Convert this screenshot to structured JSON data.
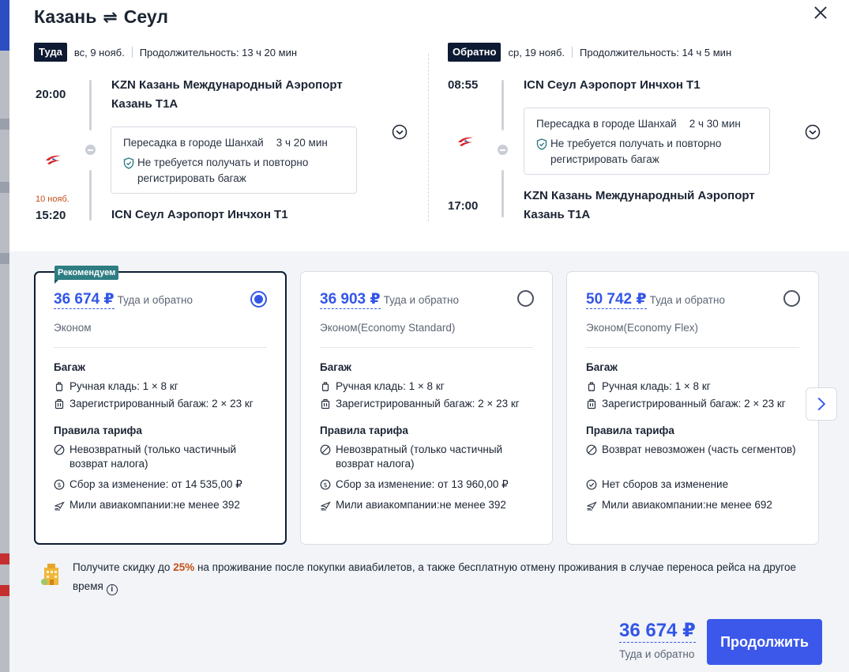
{
  "modal": {
    "origin": "Казань",
    "destination": "Сеул",
    "swap_icon": "⇌"
  },
  "outbound": {
    "tag": "Туда",
    "date": "вс, 9 нояб.",
    "duration": "Продолжительность: 13 ч 20 мин",
    "dep_time": "20:00",
    "dep_airport": "KZN Казань Международный Аэропорт Казань T1A",
    "arr_note": "10 нояб.",
    "arr_time": "15:20",
    "arr_airport": "ICN Сеул Аэропорт Инчхон T1",
    "transfer_city": "Пересадка в городе Шанхай",
    "transfer_time": "3 ч 20 мин",
    "transfer_note": "Не требуется получать и повторно регистрировать багаж"
  },
  "return": {
    "tag": "Обратно",
    "date": "ср, 19 нояб.",
    "duration": "Продолжительность: 14 ч 5 мин",
    "dep_time": "08:55",
    "dep_airport": "ICN Сеул Аэропорт Инчхон T1",
    "arr_time": "17:00",
    "arr_airport": "KZN Казань Международный Аэропорт Казань T1A",
    "transfer_city": "Пересадка в городе Шанхай",
    "transfer_time": "2 ч 30 мин",
    "transfer_note": "Не требуется получать и повторно регистрировать багаж"
  },
  "fares": [
    {
      "badge": "Рекомендуем",
      "price": "36 674 ₽",
      "price_sub": "Туда и обратно",
      "class": "Эконом",
      "selected": true,
      "baggage_title": "Багаж",
      "hand": "Ручная кладь: 1 × 8 кг",
      "checked": "Зарегистрированный багаж: 2 × 23 кг",
      "rules_title": "Правила тарифа",
      "refund": "Невозвратный (только частичный возврат налога)",
      "change": "Сбор за изменение: от 14 535,00 ₽",
      "miles": "Мили авиакомпании:не менее 392"
    },
    {
      "price": "36 903 ₽",
      "price_sub": "Туда и обратно",
      "class": "Эконом(Economy Standard)",
      "selected": false,
      "baggage_title": "Багаж",
      "hand": "Ручная кладь: 1 × 8 кг",
      "checked": "Зарегистрированный багаж: 2 × 23 кг",
      "rules_title": "Правила тарифа",
      "refund": "Невозвратный (только частичный возврат налога)",
      "change": "Сбор за изменение: от 13 960,00 ₽",
      "miles": "Мили авиакомпании:не менее 392"
    },
    {
      "price": "50 742 ₽",
      "price_sub": "Туда и обратно",
      "class": "Эконом(Economy Flex)",
      "selected": false,
      "baggage_title": "Багаж",
      "hand": "Ручная кладь: 1 × 8 кг",
      "checked": "Зарегистрированный багаж: 2 × 23 кг",
      "rules_title": "Правила тарифа",
      "refund": "Возврат невозможен (часть сегментов)",
      "change": "Нет сборов за изменение",
      "miles": "Мили авиакомпании:не менее 692"
    }
  ],
  "promo": {
    "text_before": "Получите скидку до ",
    "percent": "25%",
    "text_after": " на проживание после покупки авиабилетов, а также бесплатную отмену проживания в случае переноса рейса на другое время",
    "info_icon": "i"
  },
  "footer": {
    "total_price": "36 674 ₽",
    "total_sub": "Туда и обратно",
    "continue_label": "Продолжить"
  },
  "colors": {
    "accent": "#3356e8",
    "button": "#3b58ea",
    "badge": "#2e7d83",
    "dark_tag": "#0e1a33",
    "warning": "#c2511a"
  }
}
